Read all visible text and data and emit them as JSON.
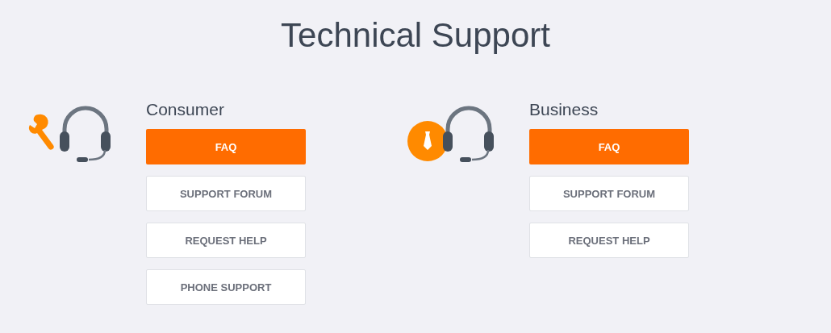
{
  "title": "Technical Support",
  "sections": [
    {
      "heading": "Consumer",
      "kind": "wrench",
      "buttons": [
        {
          "label": "FAQ",
          "kind": "primary"
        },
        {
          "label": "SUPPORT FORUM",
          "kind": "secondary"
        },
        {
          "label": "REQUEST HELP",
          "kind": "secondary"
        },
        {
          "label": "PHONE SUPPORT",
          "kind": "secondary"
        }
      ]
    },
    {
      "heading": "Business",
      "kind": "tie",
      "buttons": [
        {
          "label": "FAQ",
          "kind": "primary"
        },
        {
          "label": "SUPPORT FORUM",
          "kind": "secondary"
        },
        {
          "label": "REQUEST HELP",
          "kind": "secondary"
        }
      ]
    }
  ]
}
